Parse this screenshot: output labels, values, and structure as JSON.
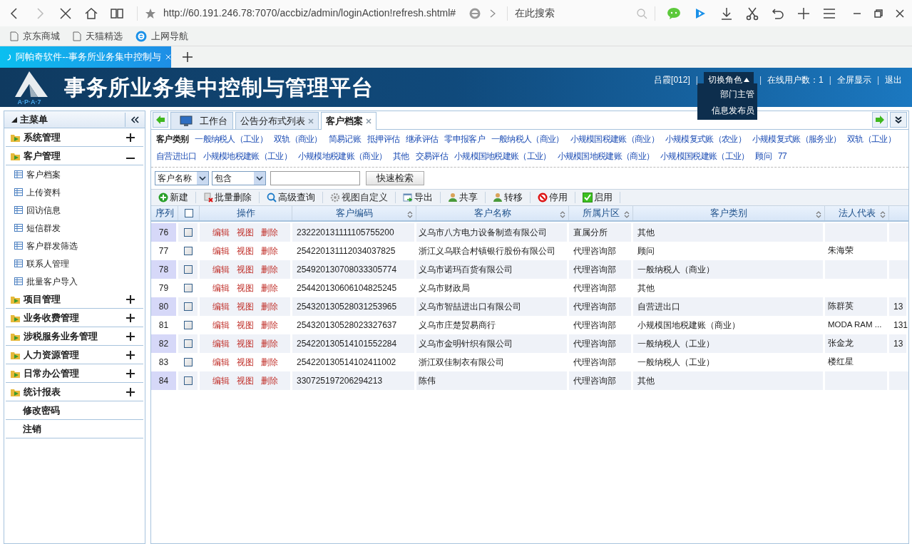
{
  "browser": {
    "url": "http://60.191.246.78:7070/accbiz/admin/loginAction!refresh.shtml#",
    "search_placeholder": "在此搜索",
    "bookmarks": [
      {
        "label": "京东商城",
        "kind": "page"
      },
      {
        "label": "天猫精选",
        "kind": "page"
      },
      {
        "label": "上网导航",
        "kind": "ie"
      }
    ],
    "tabs": [
      {
        "title": "阿帕奇软件--事务所业务集中控制与",
        "selected": true
      }
    ]
  },
  "app": {
    "title": "事务所业务集中控制与管理平台",
    "logo_text": "A·P·A·7"
  },
  "user_bar": {
    "separator": "|",
    "user": "吕霞[012]",
    "role_switch": "切换角色",
    "role_menu": [
      "部门主管",
      "信息发布员"
    ],
    "online": "在线用户数：1",
    "fullscreen": "全屏显示",
    "logout": "退出"
  },
  "sidebar": {
    "title": "主菜单",
    "items": [
      {
        "kind": "group",
        "label": "系统管理",
        "expanded": false
      },
      {
        "kind": "group",
        "label": "客户管理",
        "expanded": true,
        "children": [
          "客户档案",
          "上传资料",
          "回访信息",
          "短信群发",
          "客户群发筛选",
          "联系人管理",
          "批量客户导入"
        ]
      },
      {
        "kind": "group",
        "label": "项目管理",
        "expanded": false
      },
      {
        "kind": "group",
        "label": "业务收费管理",
        "expanded": false
      },
      {
        "kind": "group",
        "label": "涉税服务业务管理",
        "expanded": false
      },
      {
        "kind": "group",
        "label": "人力资源管理",
        "expanded": false
      },
      {
        "kind": "group",
        "label": "日常办公管理",
        "expanded": false
      },
      {
        "kind": "group",
        "label": "统计报表",
        "expanded": false
      },
      {
        "kind": "link",
        "label": "修改密码"
      },
      {
        "kind": "link",
        "label": "注销"
      }
    ]
  },
  "tabs": [
    {
      "label": "工作台",
      "kind": "home",
      "selected": false
    },
    {
      "label": "公告分布式列表",
      "kind": "closable",
      "selected": false
    },
    {
      "label": "客户档案",
      "kind": "closable",
      "selected": true
    }
  ],
  "filter": {
    "label": "客户类别",
    "categories": [
      "一般纳税人（工业）",
      "双轨（商业）",
      "简易记账",
      "抵押评估",
      "继承评估",
      "零申报客户",
      "一般纳税人（商业）",
      "小规模国税建账（商业）",
      "小规模复式账（农业）",
      "小规模复式账（服务业）",
      "双轨（工业）",
      "自营进出口",
      "小规模地税建账（工业）",
      "小规模地税建账（商业）",
      "其他",
      "交易评估",
      "小规模国地税建账（工业）",
      "小规模国地税建账（商业）",
      "小规模国税建账（工业）",
      "顾问",
      "77"
    ]
  },
  "search": {
    "field": "客户名称",
    "operator": "包含",
    "button": "快速检索"
  },
  "toolbar": [
    {
      "kind": "add",
      "label": "新建"
    },
    {
      "kind": "batch-delete",
      "label": "批量删除"
    },
    {
      "kind": "search",
      "label": "高级查询"
    },
    {
      "kind": "gear",
      "label": "视图自定义"
    },
    {
      "kind": "export",
      "label": "导出"
    },
    {
      "kind": "share",
      "label": "共享"
    },
    {
      "kind": "transfer",
      "label": "转移"
    },
    {
      "kind": "disable",
      "label": "停用"
    },
    {
      "kind": "enable",
      "label": "启用"
    }
  ],
  "table": {
    "columns": [
      {
        "label": "序列",
        "sortable": false
      },
      {
        "label": "操作",
        "sortable": false
      },
      {
        "label": "客户编码",
        "sortable": true
      },
      {
        "label": "客户名称",
        "sortable": true
      },
      {
        "label": "所属片区",
        "sortable": true
      },
      {
        "label": "客户类别",
        "sortable": true
      },
      {
        "label": "法人代表",
        "sortable": true
      }
    ],
    "header_checked": false,
    "rows": [
      {
        "index": "76",
        "checked": false,
        "actions": [
          "编辑",
          "视图",
          "删除"
        ],
        "code": "232220131111105755200",
        "name": "义乌市八方电力设备制造有限公司",
        "area": "直属分所",
        "category": "其他"
      },
      {
        "index": "77",
        "checked": false,
        "actions": [
          "编辑",
          "视图",
          "删除"
        ],
        "code": "254220131112034037825",
        "name": "浙江义乌联合村镇银行股份有限公司",
        "area": "代理咨询部",
        "category": "顾问",
        "legal_rep": "朱海荣"
      },
      {
        "index": "78",
        "checked": false,
        "actions": [
          "编辑",
          "视图",
          "删除"
        ],
        "code": "254920130708033305774",
        "name": "义乌市诺玛百货有限公司",
        "area": "代理咨询部",
        "category": "一般纳税人（商业）"
      },
      {
        "index": "79",
        "checked": false,
        "actions": [
          "编辑",
          "视图",
          "删除"
        ],
        "code": "254420130606104825245",
        "name": "义乌市财政局",
        "area": "代理咨询部",
        "category": "其他"
      },
      {
        "index": "80",
        "checked": false,
        "actions": [
          "编辑",
          "视图",
          "删除"
        ],
        "code": "254320130528031253965",
        "name": "义乌市智喆进出口有限公司",
        "area": "代理咨询部",
        "category": "自营进出口",
        "legal_rep": "陈群英",
        "column_9": "13"
      },
      {
        "index": "81",
        "checked": false,
        "actions": [
          "编辑",
          "视图",
          "删除"
        ],
        "code": "254320130528023327637",
        "name": "义乌市庄楚贸易商行",
        "area": "代理咨询部",
        "category": "小规模国地税建账（商业）",
        "legal_rep": "MODA RAM ...",
        "column_9": "131"
      },
      {
        "index": "82",
        "checked": false,
        "actions": [
          "编辑",
          "视图",
          "删除"
        ],
        "code": "254220130514101552284",
        "name": "义乌市金明针织有限公司",
        "area": "代理咨询部",
        "category": "一般纳税人（工业）",
        "legal_rep": "张金龙",
        "column_9": "13"
      },
      {
        "index": "83",
        "checked": false,
        "actions": [
          "编辑",
          "视图",
          "删除"
        ],
        "code": "254220130514102411002",
        "name": "浙江双佳制衣有限公司",
        "area": "代理咨询部",
        "category": "一般纳税人（工业）",
        "legal_rep": "楼红星"
      },
      {
        "index": "84",
        "checked": false,
        "actions": [
          "编辑",
          "视图",
          "删除"
        ],
        "code": "330725197206294213",
        "name": "陈伟",
        "area": "代理咨询部",
        "category": "其他"
      }
    ]
  }
}
